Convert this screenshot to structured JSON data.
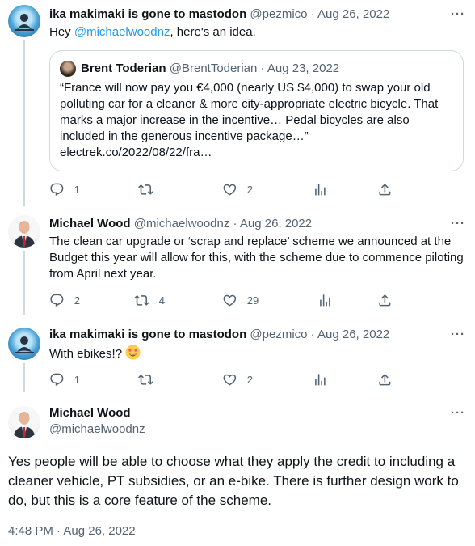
{
  "tweets": [
    {
      "name": "ika makimaki is gone to mastodon",
      "handle": "@pezmico",
      "separator": "·",
      "date": "Aug 26, 2022",
      "text_before": "Hey ",
      "mention": "@michaelwoodnz",
      "text_after": ", here's an idea.",
      "quote": {
        "name": "Brent Toderian",
        "handle": "@BrentToderian",
        "separator": "·",
        "date": "Aug 23, 2022",
        "text": "“France will now pay you €4,000 (nearly US $4,000) to swap your old polluting car for a cleaner & more city-appropriate electric bicycle. That marks a major increase in the incentive… Pedal bicycles are also included in the generous incentive package…” electrek.co/2022/08/22/fra…"
      },
      "replies": "1",
      "retweets": "",
      "likes": "2"
    },
    {
      "name": "Michael Wood",
      "handle": "@michaelwoodnz",
      "separator": "·",
      "date": "Aug 26, 2022",
      "text": "The clean car upgrade or ‘scrap and replace’ scheme we announced at the Budget this year will allow for this, with the scheme due to commence piloting from April next year.",
      "replies": "2",
      "retweets": "4",
      "likes": "29"
    },
    {
      "name": "ika makimaki is gone to mastodon",
      "handle": "@pezmico",
      "separator": "·",
      "date": "Aug 26, 2022",
      "text": "With ebikes!?",
      "emoji": "star-struck-emoji",
      "replies": "1",
      "retweets": "",
      "likes": "2"
    }
  ],
  "main_tweet": {
    "name": "Michael Wood",
    "handle": "@michaelwoodnz",
    "text": "Yes people will be able to choose what they apply the credit to including a cleaner vehicle, PT subsidies, or an e-bike. There is further design work to do, but this is a core feature of the scheme.",
    "timestamp": "4:48 PM · Aug 26, 2022"
  },
  "more_label": "···",
  "icons": [
    "reply-icon",
    "retweet-icon",
    "like-icon",
    "views-icon",
    "share-icon",
    "more-icon"
  ]
}
